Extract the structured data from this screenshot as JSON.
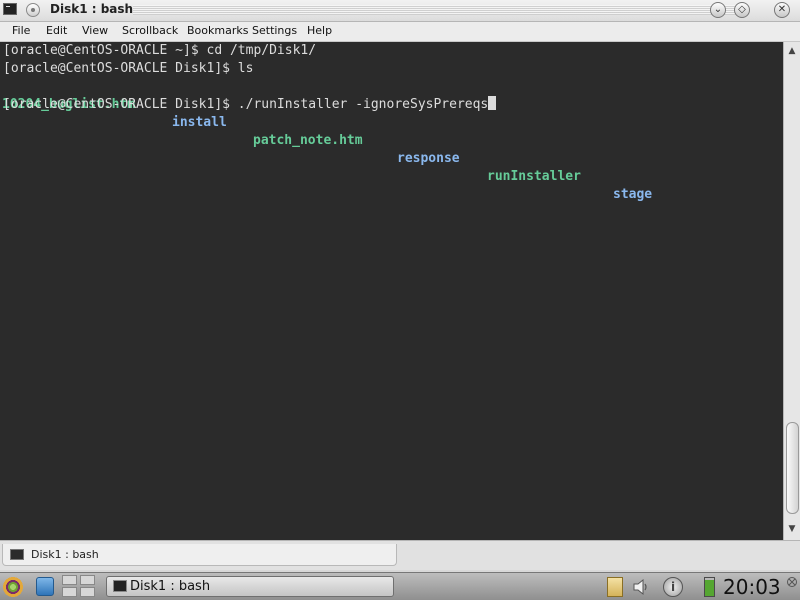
{
  "window": {
    "title": "Disk1 : bash"
  },
  "menu": [
    "File",
    "Edit",
    "View",
    "Scrollback",
    "Bookmarks",
    "Settings",
    "Help"
  ],
  "terminal": {
    "lines": [
      "[oracle@CentOS-ORACLE ~]$ cd /tmp/Disk1/",
      "[oracle@CentOS-ORACLE Disk1]$ ls"
    ],
    "ls_output": [
      {
        "name": "10204_buglist.htm",
        "color": "green"
      },
      {
        "name": "install",
        "color": "blue"
      },
      {
        "name": "patch_note.htm",
        "color": "green"
      },
      {
        "name": "response",
        "color": "blue"
      },
      {
        "name": "runInstaller",
        "color": "green"
      },
      {
        "name": "stage",
        "color": "blue"
      }
    ],
    "current_line": "[oracle@CentOS-ORACLE Disk1]$ ./runInstaller -ignoreSysPrereqs"
  },
  "session_tab": {
    "label": "Disk1 : bash"
  },
  "taskbar": {
    "task_label": "Disk1 : bash",
    "clock": "20:03"
  },
  "colors": {
    "terminal_bg": "#2b2b2b",
    "terminal_fg": "#dddddd",
    "ls_green": "#66cc99",
    "ls_blue": "#8ab8ee"
  },
  "icons": [
    "terminal-icon",
    "kmenu-icon",
    "desktop-icon",
    "pager-icon",
    "clipboard-icon",
    "volume-icon",
    "info-icon",
    "battery-icon"
  ]
}
